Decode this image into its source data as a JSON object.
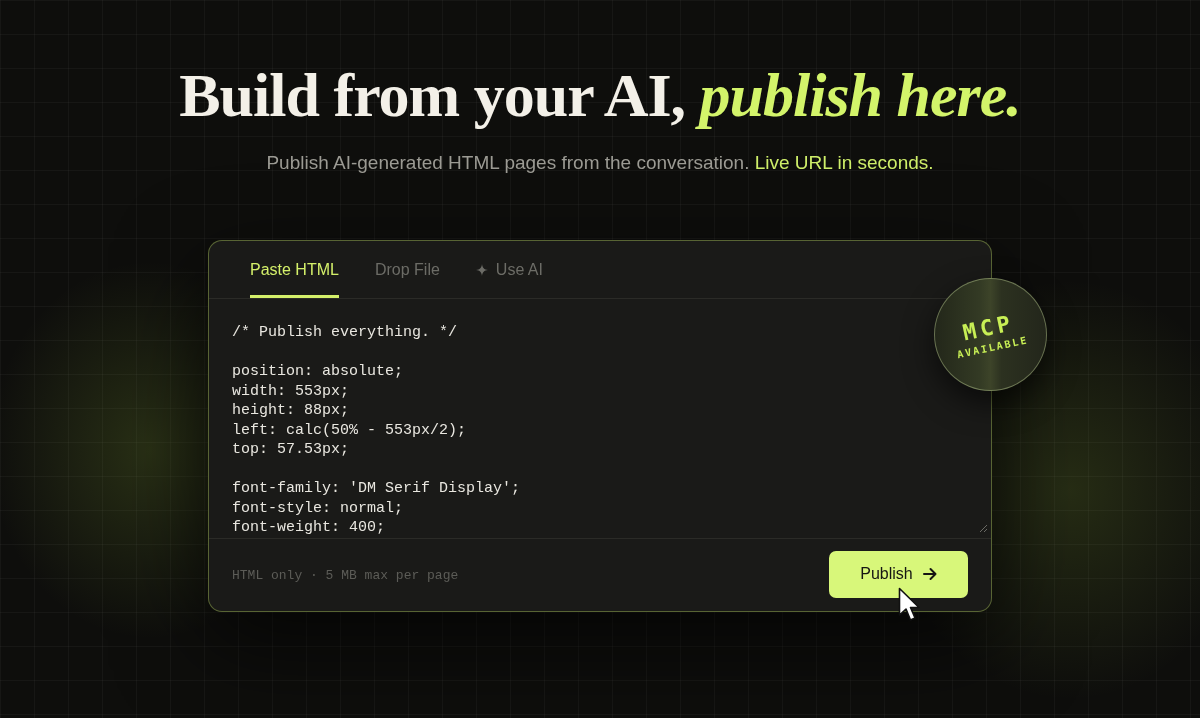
{
  "hero": {
    "title": "Build from your AI,",
    "title_highlight": "publish here.",
    "subtitle": "Publish AI-generated HTML pages from the conversation.",
    "subtitle_highlight": "Live URL in seconds."
  },
  "composer": {
    "tabs": [
      {
        "label": "Paste HTML",
        "selected": true,
        "kind": "text"
      },
      {
        "label": "Drop File",
        "selected": false,
        "kind": "text"
      },
      {
        "label": "Use AI",
        "selected": false,
        "kind": "sparkle"
      }
    ],
    "editor": {
      "value": "/* Publish everything. */\n\nposition: absolute;\nwidth: 553px;\nheight: 88px;\nleft: calc(50% - 553px/2);\ntop: 57.53px;\n\nfont-family: 'DM Serif Display';\nfont-style: normal;\nfont-weight: 400;"
    },
    "note": "HTML only · 5 MB max per page",
    "publish_button": "Publish"
  },
  "badge": {
    "title": "MCP",
    "subtitle": "AVAILABLE"
  }
}
